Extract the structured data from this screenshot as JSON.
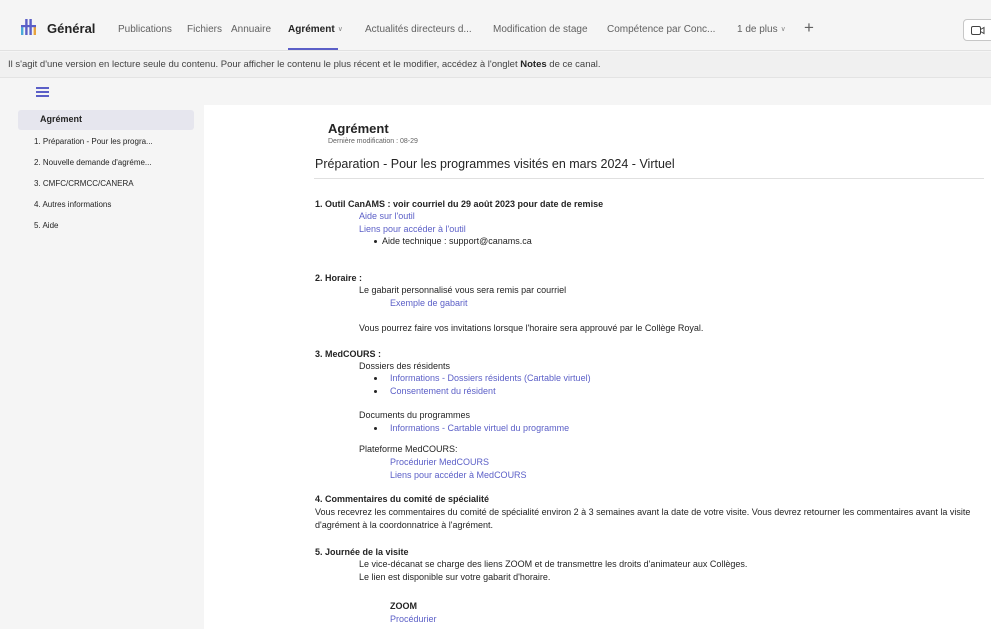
{
  "header": {
    "channel_title": "Général",
    "tabs": [
      "Publications",
      "Fichiers",
      "Annuaire",
      "Agrément",
      "Actualités directeurs d...",
      "Modification de stage",
      "Compétence par Conc...",
      "1 de plus"
    ],
    "active_tab": "Agrément",
    "add_tab_icon": "plus-icon",
    "meet_icon": "video-camera-icon"
  },
  "banner": {
    "text_before": "Il s'agit d'une version en lecture seule du contenu. Pour afficher le contenu le plus récent et le modifier, accédez à l'onglet ",
    "bold": "Notes",
    "text_after": " de ce canal."
  },
  "nav": {
    "items": [
      "Agrément",
      "1. Préparation - Pour les progra...",
      "2. Nouvelle demande d'agréme...",
      "3. CMFC/CRMCC/CANERA",
      "4. Autres informations",
      "5. Aide"
    ]
  },
  "content": {
    "title": "Agrément",
    "last_modified": "Dernière modification : 08-29",
    "page_heading": "Préparation - Pour les programmes visités en mars 2024 - Virtuel",
    "s1": {
      "heading": "1. Outil CanAMS : voir courriel du 29 août 2023 pour date de remise",
      "link1": "Aide sur l'outil",
      "link2": "Liens pour accéder à l'outil",
      "bullet": "Aide technique : support@canams.ca"
    },
    "s2": {
      "heading": "2. Horaire :",
      "line1": "Le gabarit personnalisé vous sera remis par courriel",
      "link": "Exemple de gabarit",
      "line2": "Vous pourrez faire vos invitations lorsque l'horaire sera approuvé par le Collège Royal."
    },
    "s3": {
      "heading": "3. MedCOURS :",
      "sub1": "Dossiers des résidents",
      "sub1_b1": "Informations - Dossiers résidents (Cartable virtuel)",
      "sub1_b2": "Consentement du résident",
      "sub2": "Documents du programmes",
      "sub2_b1": "Informations - Cartable virtuel du programme",
      "sub3": "Plateforme MedCOURS:",
      "sub3_l1": "Procédurier MedCOURS",
      "sub3_l2": "Liens pour accéder à MedCOURS"
    },
    "s4": {
      "heading": "4. Commentaires du comité de spécialité",
      "para": "Vous recevrez les commentaires du comité de spécialité environ 2 à 3 semaines avant la date de votre visite. Vous devrez retourner les commentaires avant la visite d'agrément à la coordonnatrice à l'agrément."
    },
    "s5": {
      "heading": "5. Journée de la visite",
      "line1": "Le vice-décanat se charge des liens ZOOM et de transmettre les droits d'animateur aux Collèges.",
      "line2": "Le lien est disponible sur votre gabarit d'horaire.",
      "zoom": "ZOOM",
      "link": "Procédurier"
    }
  }
}
